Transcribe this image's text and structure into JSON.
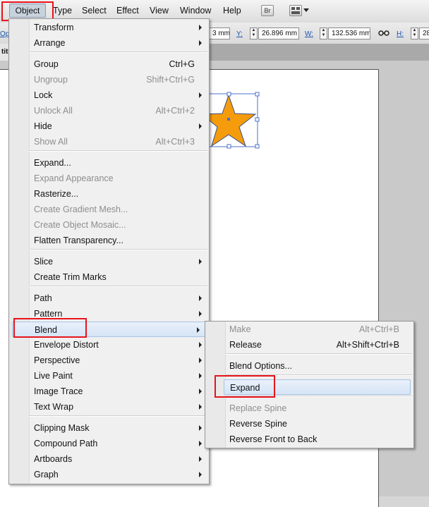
{
  "menubar": {
    "items": [
      "Object",
      "Type",
      "Select",
      "Effect",
      "View",
      "Window",
      "Help"
    ],
    "bridge_label": "Br"
  },
  "controlbar": {
    "x_partial": "3 mm",
    "y_label": "Y:",
    "y_value": "26.896 mm",
    "w_label": "W:",
    "w_value": "132.536 mm",
    "h_label": "H:",
    "h_partial": "28",
    "op_partial": "Op"
  },
  "tab": {
    "label": "titl"
  },
  "object_menu": {
    "items": [
      {
        "label": "Transform",
        "shortcut": "",
        "submenu": true,
        "disabled": false
      },
      {
        "label": "Arrange",
        "shortcut": "",
        "submenu": true,
        "disabled": false
      },
      {
        "label": "Group",
        "shortcut": "Ctrl+G",
        "submenu": false,
        "disabled": false
      },
      {
        "label": "Ungroup",
        "shortcut": "Shift+Ctrl+G",
        "submenu": false,
        "disabled": true
      },
      {
        "label": "Lock",
        "shortcut": "",
        "submenu": true,
        "disabled": false
      },
      {
        "label": "Unlock All",
        "shortcut": "Alt+Ctrl+2",
        "submenu": false,
        "disabled": true
      },
      {
        "label": "Hide",
        "shortcut": "",
        "submenu": true,
        "disabled": false
      },
      {
        "label": "Show All",
        "shortcut": "Alt+Ctrl+3",
        "submenu": false,
        "disabled": true
      },
      {
        "label": "Expand...",
        "shortcut": "",
        "submenu": false,
        "disabled": false
      },
      {
        "label": "Expand Appearance",
        "shortcut": "",
        "submenu": false,
        "disabled": true
      },
      {
        "label": "Rasterize...",
        "shortcut": "",
        "submenu": false,
        "disabled": false
      },
      {
        "label": "Create Gradient Mesh...",
        "shortcut": "",
        "submenu": false,
        "disabled": true
      },
      {
        "label": "Create Object Mosaic...",
        "shortcut": "",
        "submenu": false,
        "disabled": true
      },
      {
        "label": "Flatten Transparency...",
        "shortcut": "",
        "submenu": false,
        "disabled": false
      },
      {
        "label": "Slice",
        "shortcut": "",
        "submenu": true,
        "disabled": false
      },
      {
        "label": "Create Trim Marks",
        "shortcut": "",
        "submenu": false,
        "disabled": false
      },
      {
        "label": "Path",
        "shortcut": "",
        "submenu": true,
        "disabled": false
      },
      {
        "label": "Pattern",
        "shortcut": "",
        "submenu": true,
        "disabled": false
      },
      {
        "label": "Blend",
        "shortcut": "",
        "submenu": true,
        "disabled": false
      },
      {
        "label": "Envelope Distort",
        "shortcut": "",
        "submenu": true,
        "disabled": false
      },
      {
        "label": "Perspective",
        "shortcut": "",
        "submenu": true,
        "disabled": false
      },
      {
        "label": "Live Paint",
        "shortcut": "",
        "submenu": true,
        "disabled": false
      },
      {
        "label": "Image Trace",
        "shortcut": "",
        "submenu": true,
        "disabled": false
      },
      {
        "label": "Text Wrap",
        "shortcut": "",
        "submenu": true,
        "disabled": false
      },
      {
        "label": "Clipping Mask",
        "shortcut": "",
        "submenu": true,
        "disabled": false
      },
      {
        "label": "Compound Path",
        "shortcut": "",
        "submenu": true,
        "disabled": false
      },
      {
        "label": "Artboards",
        "shortcut": "",
        "submenu": true,
        "disabled": false
      },
      {
        "label": "Graph",
        "shortcut": "",
        "submenu": true,
        "disabled": false
      }
    ]
  },
  "blend_menu": {
    "items": [
      {
        "label": "Make",
        "shortcut": "Alt+Ctrl+B",
        "disabled": true
      },
      {
        "label": "Release",
        "shortcut": "Alt+Shift+Ctrl+B",
        "disabled": false
      },
      {
        "label": "Blend Options...",
        "shortcut": "",
        "disabled": false
      },
      {
        "label": "Expand",
        "shortcut": "",
        "disabled": false
      },
      {
        "label": "Replace Spine",
        "shortcut": "",
        "disabled": true
      },
      {
        "label": "Reverse Spine",
        "shortcut": "",
        "disabled": false
      },
      {
        "label": "Reverse Front to Back",
        "shortcut": "",
        "disabled": false
      }
    ]
  },
  "colors": {
    "star_fill": "#f59c0c",
    "selection": "#4a6fd0",
    "highlight_box": "#e8141b"
  }
}
